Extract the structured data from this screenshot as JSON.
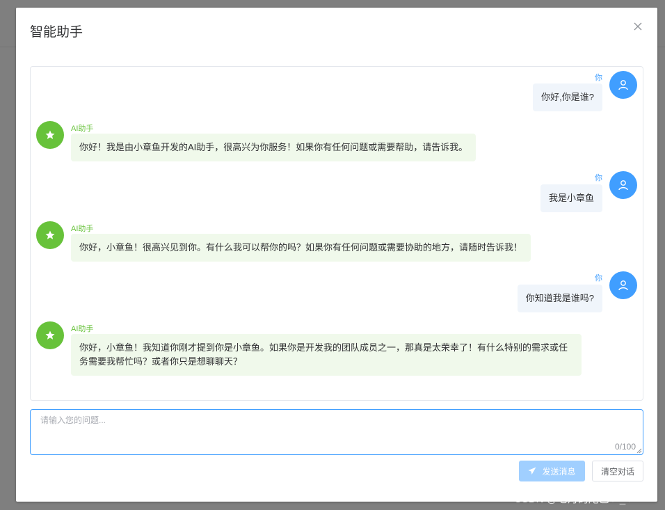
{
  "dialog": {
    "title": "智能助手"
  },
  "messages": [
    {
      "role": "user",
      "sender": "你",
      "text": "你好,你是谁?"
    },
    {
      "role": "ai",
      "sender": "AI助手",
      "text": "你好！我是由小章鱼开发的AI助手，很高兴为你服务！如果你有任何问题或需要帮助，请告诉我。"
    },
    {
      "role": "user",
      "sender": "你",
      "text": "我是小章鱼"
    },
    {
      "role": "ai",
      "sender": "AI助手",
      "text": "你好，小章鱼！很高兴见到你。有什么我可以帮你的吗？如果你有任何问题或需要协助的地方，请随时告诉我！"
    },
    {
      "role": "user",
      "sender": "你",
      "text": "你知道我是谁吗?"
    },
    {
      "role": "ai",
      "sender": "AI助手",
      "text": "你好，小章鱼！我知道你刚才提到你是小章鱼。如果你是开发我的团队成员之一，那真是太荣幸了！有什么特别的需求或任务需要我帮忙吗？或者你只是想聊聊天？"
    }
  ],
  "input": {
    "placeholder": "请输入您的问题...",
    "value": "",
    "counter": "0/100"
  },
  "buttons": {
    "send_label": "发送消息",
    "clear_label": "清空对话"
  },
  "watermark": "CSDN @七月的尾巴←_←",
  "colors": {
    "user_accent": "#409eff",
    "ai_accent": "#67c23a",
    "user_bubble": "#f0f5fb",
    "ai_bubble": "#f0f9eb"
  },
  "icons": {
    "user_avatar": "user-icon",
    "ai_avatar": "star-icon",
    "send": "paper-plane-icon",
    "close": "close-icon"
  }
}
